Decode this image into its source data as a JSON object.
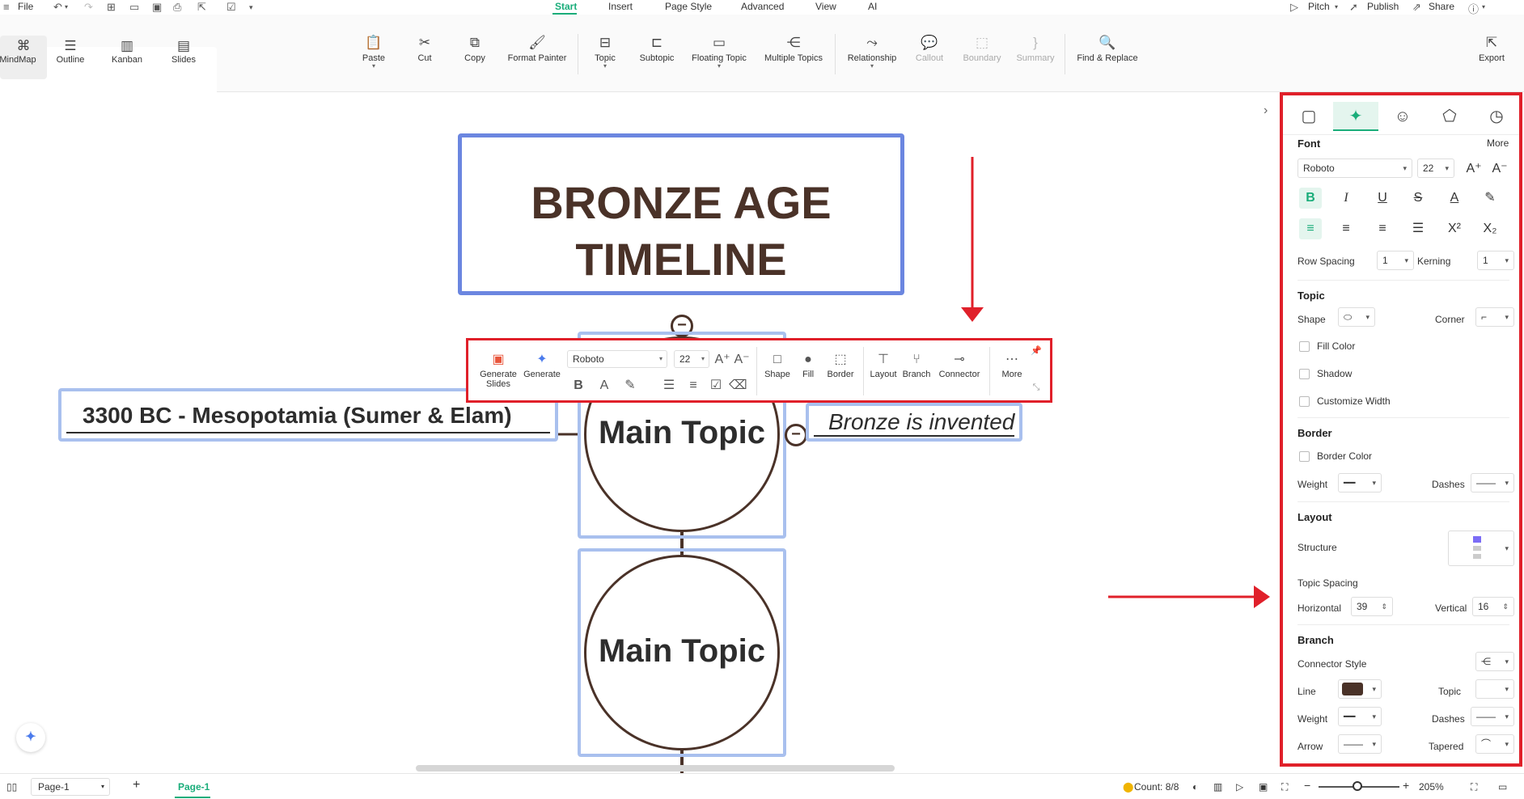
{
  "menu": {
    "file": "File",
    "tabs": [
      "Start",
      "Insert",
      "Page Style",
      "Advanced",
      "View",
      "AI"
    ],
    "right": {
      "pitch": "Pitch",
      "publish": "Publish",
      "share": "Share"
    }
  },
  "views": [
    "MindMap",
    "Outline",
    "Kanban",
    "Slides"
  ],
  "ribbon": {
    "paste": "Paste",
    "cut": "Cut",
    "copy": "Copy",
    "format_painter": "Format Painter",
    "topic": "Topic",
    "subtopic": "Subtopic",
    "floating_topic": "Floating Topic",
    "multiple_topics": "Multiple Topics",
    "relationship": "Relationship",
    "callout": "Callout",
    "boundary": "Boundary",
    "summary": "Summary",
    "find_replace": "Find & Replace",
    "export": "Export"
  },
  "canvas": {
    "title_line1": "BRONZE AGE",
    "title_line2": "TIMELINE",
    "left_topic": "3300 BC - Mesopotamia (Sumer & Elam)",
    "main_topic_1": "Main Topic",
    "main_topic_2": "Main Topic",
    "right_topic": "Bronze is invented"
  },
  "floating_toolbar": {
    "generate_slides": "Generate Slides",
    "generate": "Generate",
    "font": "Roboto",
    "size": "22",
    "shape": "Shape",
    "fill": "Fill",
    "border": "Border",
    "layout": "Layout",
    "branch": "Branch",
    "connector": "Connector",
    "more": "More"
  },
  "panel": {
    "font_section": "Font",
    "more": "More",
    "font_name": "Roboto",
    "font_size": "22",
    "row_spacing_label": "Row Spacing",
    "row_spacing": "1",
    "kerning_label": "Kerning",
    "kerning": "1",
    "topic_section": "Topic",
    "shape_label": "Shape",
    "corner_label": "Corner",
    "fill_color": "Fill Color",
    "shadow": "Shadow",
    "customize_width": "Customize Width",
    "border_section": "Border",
    "border_color": "Border Color",
    "weight_label": "Weight",
    "dashes_label": "Dashes",
    "layout_section": "Layout",
    "structure_label": "Structure",
    "topic_spacing_label": "Topic Spacing",
    "horizontal_label": "Horizontal",
    "horizontal": "39",
    "vertical_label": "Vertical",
    "vertical": "16",
    "branch_section": "Branch",
    "connector_style_label": "Connector Style",
    "line_label": "Line",
    "topic_label": "Topic",
    "weight2_label": "Weight",
    "dashes2_label": "Dashes",
    "arrow_label": "Arrow",
    "tapered_label": "Tapered",
    "line_color": "#4a3228"
  },
  "status": {
    "page_select": "Page-1",
    "page_tab": "Page-1",
    "count": "Count: 8/8",
    "zoom": "205%"
  },
  "colors": {
    "accent": "#1aad7a",
    "highlight": "#e0202a",
    "topic_border": "#6b86e0",
    "topic_text": "#4a3228"
  }
}
